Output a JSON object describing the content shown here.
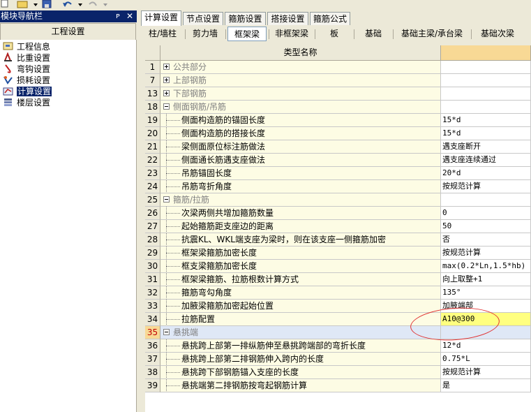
{
  "nav": {
    "title": "模块导航栏",
    "pin_glyph": "ᴘ",
    "close_glyph": "✕",
    "header": "工程设置",
    "items": [
      {
        "label": "工程信息",
        "icon": "project-info-icon"
      },
      {
        "label": "比重设置",
        "icon": "weight-icon"
      },
      {
        "label": "弯钩设置",
        "icon": "hook-icon"
      },
      {
        "label": "损耗设置",
        "icon": "loss-icon"
      },
      {
        "label": "计算设置",
        "icon": "calc-icon"
      },
      {
        "label": "楼层设置",
        "icon": "floor-icon"
      }
    ],
    "selected": "计算设置"
  },
  "tabs": [
    "计算设置",
    "节点设置",
    "箍筋设置",
    "搭接设置",
    "箍筋公式"
  ],
  "subtabs": [
    "柱/墙柱",
    "剪力墙",
    "框架梁",
    "非框架梁",
    "板",
    "基础",
    "基础主梁/承台梁",
    "基础次梁"
  ],
  "grid": {
    "header_name": "类型名称",
    "header_value": "",
    "rows": [
      {
        "num": "1",
        "name": "公共部分",
        "type": "group",
        "state": "collapsed",
        "value": ""
      },
      {
        "num": "7",
        "name": "上部钢筋",
        "type": "group",
        "state": "collapsed",
        "value": ""
      },
      {
        "num": "13",
        "name": "下部钢筋",
        "type": "group",
        "state": "collapsed",
        "value": ""
      },
      {
        "num": "18",
        "name": "侧面钢筋/吊筋",
        "type": "group",
        "state": "expanded",
        "value": ""
      },
      {
        "num": "19",
        "name": "侧面构造筋的锚固长度",
        "type": "item",
        "value": "15*d"
      },
      {
        "num": "20",
        "name": "侧面构造筋的搭接长度",
        "type": "item",
        "value": "15*d"
      },
      {
        "num": "21",
        "name": "梁侧面原位标注筋做法",
        "type": "item",
        "value": "遇支座断开"
      },
      {
        "num": "22",
        "name": "侧面通长筋遇支座做法",
        "type": "item",
        "value": "遇支座连续通过"
      },
      {
        "num": "23",
        "name": "吊筋锚固长度",
        "type": "item",
        "value": "20*d"
      },
      {
        "num": "24",
        "name": "吊筋弯折角度",
        "type": "item",
        "value": "按规范计算"
      },
      {
        "num": "25",
        "name": "箍筋/拉筋",
        "type": "group",
        "state": "expanded",
        "value": ""
      },
      {
        "num": "26",
        "name": "次梁两侧共增加箍筋数量",
        "type": "item",
        "value": "0"
      },
      {
        "num": "27",
        "name": "起始箍筋距支座边的距离",
        "type": "item",
        "value": "50"
      },
      {
        "num": "28",
        "name": "抗震KL、WKL端支座为梁时，则在该支座一侧箍筋加密",
        "type": "item",
        "value": "否"
      },
      {
        "num": "29",
        "name": "框架梁箍筋加密长度",
        "type": "item",
        "value": "按规范计算"
      },
      {
        "num": "30",
        "name": "框支梁箍筋加密长度",
        "type": "item",
        "value": "max(0.2*Ln,1.5*hb)"
      },
      {
        "num": "31",
        "name": "框架梁箍筋、拉筋根数计算方式",
        "type": "item",
        "value": "向上取整+1"
      },
      {
        "num": "32",
        "name": "箍筋弯勾角度",
        "type": "item",
        "value": "135°"
      },
      {
        "num": "33",
        "name": "加腋梁箍筋加密起始位置",
        "type": "item",
        "value": "加腋端部"
      },
      {
        "num": "34",
        "name": "拉筋配置",
        "type": "item",
        "value": "A10@300",
        "highlight": true
      },
      {
        "num": "35",
        "name": "悬挑端",
        "type": "group",
        "state": "expanded",
        "value": "",
        "selected": true
      },
      {
        "num": "36",
        "name": "悬挑跨上部第一排纵筋伸至悬挑跨端部的弯折长度",
        "type": "item",
        "value": "12*d"
      },
      {
        "num": "37",
        "name": "悬挑跨上部第二排钢筋伸入跨内的长度",
        "type": "item",
        "value": "0.75*L"
      },
      {
        "num": "38",
        "name": "悬挑跨下部钢筋锚入支座的长度",
        "type": "item",
        "value": "按规范计算"
      },
      {
        "num": "39",
        "name": "悬挑端第二排钢筋按弯起钢筋计算",
        "type": "item",
        "value": "是"
      }
    ]
  },
  "colors": {
    "nav_title_bg": "#0a246a",
    "value_header_bg": "#f8d995",
    "highlight_cell": "#ffff80",
    "annotation_circle": "#e03030"
  }
}
